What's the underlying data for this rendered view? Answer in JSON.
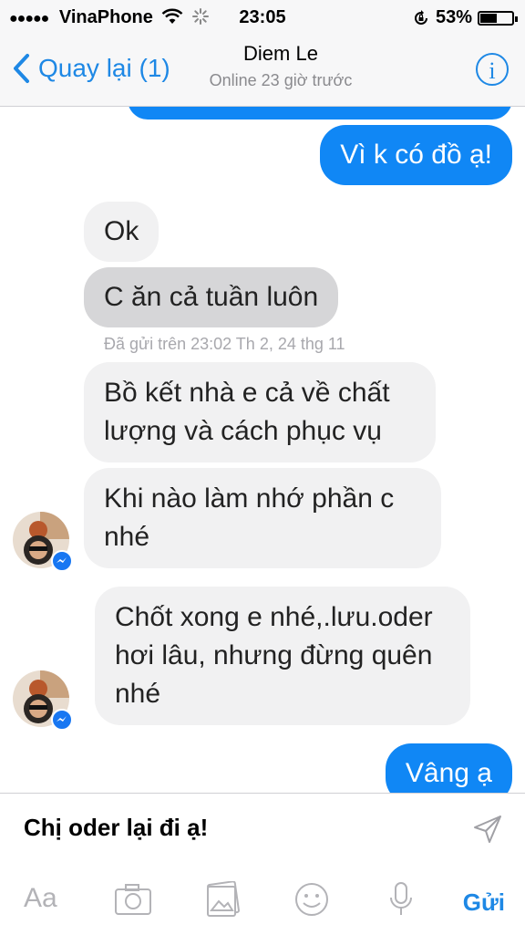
{
  "status": {
    "carrier": "VinaPhone",
    "time": "23:05",
    "battery": "53%",
    "battery_level": 0.53
  },
  "nav": {
    "back_label": "Quay lại (1)",
    "contact_name": "Diem Le",
    "presence": "Online 23 giờ trước"
  },
  "messages": [
    {
      "from": "me",
      "text": "Vì k có đồ ạ!"
    },
    {
      "from": "them",
      "text": "Ok"
    },
    {
      "from": "them",
      "text": "C ăn cả tuần luôn"
    },
    {
      "from": "them",
      "text": "Bồ kết nhà e cả về chất lượng và cách phục vụ"
    },
    {
      "from": "them",
      "text": "Khi nào làm nhớ phần c nhé"
    },
    {
      "from": "them",
      "text": "Chốt xong e nhé,.lưu.oder hơi lâu, nhưng đừng quên nhé"
    },
    {
      "from": "me",
      "text": "Vâng ạ"
    }
  ],
  "timestamp": "Đã gửi trên 23:02 Th 2, 24 thg 11",
  "composer": {
    "draft": "Chị oder lại đi ạ!",
    "aa_label": "Aa",
    "send_label": "Gửi"
  },
  "colors": {
    "accent": "#1e88e5",
    "outgoing_bubble": "#1087f5",
    "incoming_bubble": "#f1f1f2"
  },
  "icons": [
    "wifi-icon",
    "loading-icon",
    "rotation-lock-icon",
    "battery-icon",
    "back-chevron-icon",
    "info-icon",
    "messenger-badge-icon",
    "send-arrow-icon",
    "camera-icon",
    "photo-icon",
    "emoji-icon",
    "microphone-icon"
  ]
}
